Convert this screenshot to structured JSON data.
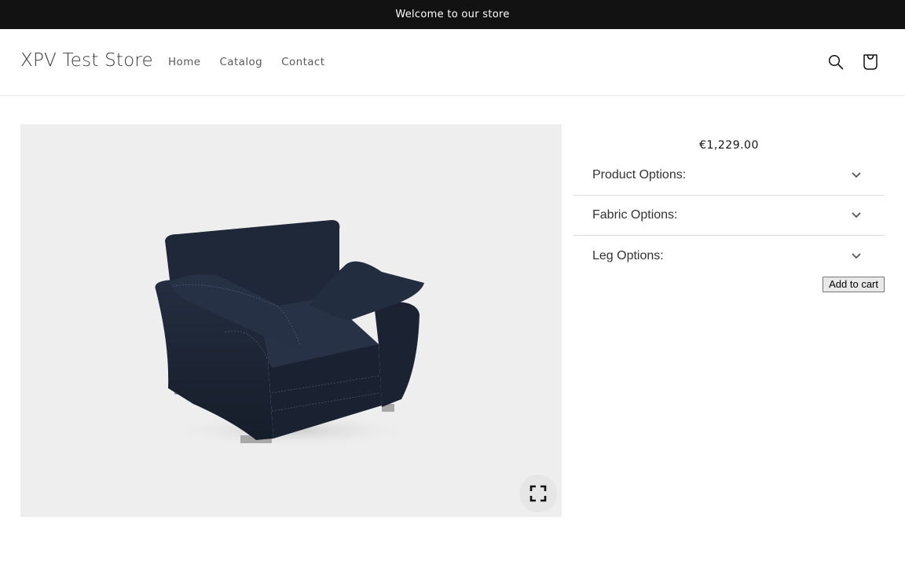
{
  "announcement": {
    "text": "Welcome to our store"
  },
  "header": {
    "store_name": "XPV Test Store",
    "nav": [
      {
        "label": "Home"
      },
      {
        "label": "Catalog"
      },
      {
        "label": "Contact"
      }
    ],
    "icons": {
      "search": "search-icon",
      "cart": "cart-bag-icon"
    }
  },
  "product": {
    "media": {
      "alt": "Dark navy velvet armchair 3D view",
      "fabric_color": "#1c2534",
      "background": "#eeeeee"
    },
    "price": "€1,229.00",
    "accordion": [
      {
        "label": "Product Options:"
      },
      {
        "label": "Fabric Options:"
      },
      {
        "label": "Leg Options:"
      }
    ],
    "add_to_cart_label": "Add to cart",
    "fullscreen_icon": "expand-fullscreen-icon"
  }
}
